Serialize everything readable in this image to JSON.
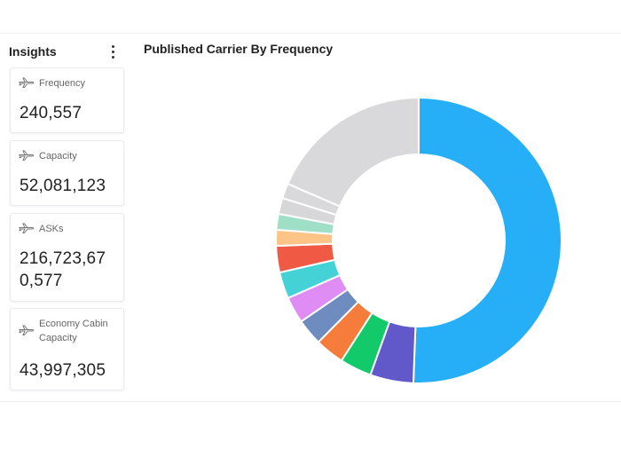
{
  "insights": {
    "title": "Insights",
    "menu_icon": "more-vertical-icon",
    "cards": [
      {
        "label": "Frequency",
        "value": "240,557",
        "icon": "airplane-icon"
      },
      {
        "label": "Capacity",
        "value": "52,081,123",
        "icon": "airplane-icon"
      },
      {
        "label": "ASKs",
        "value_line1": "216,723,67",
        "value_line2": "0,577",
        "icon": "airplane-icon"
      },
      {
        "label_line1": "Economy Cabin",
        "label_line2": "Capacity",
        "value": "43,997,305",
        "icon": "airplane-icon"
      }
    ]
  },
  "chart": {
    "title": "Published Carrier By Frequency"
  },
  "chart_data": {
    "type": "pie",
    "donut": true,
    "title": "Published Carrier By Frequency",
    "values": [
      50.6,
      4.9,
      3.6,
      3.3,
      3.0,
      3.0,
      3.0,
      3.0,
      1.8,
      1.8,
      1.8,
      1.7,
      18.5
    ],
    "colors": [
      "#26aef6",
      "#6159c9",
      "#12ca6a",
      "#f57c3a",
      "#6e8cbf",
      "#df8cf5",
      "#45d2d6",
      "#f05a44",
      "#fcc487",
      "#9fdec7",
      "#d7d7d9"
    ],
    "last_color": "#d9d9db"
  }
}
